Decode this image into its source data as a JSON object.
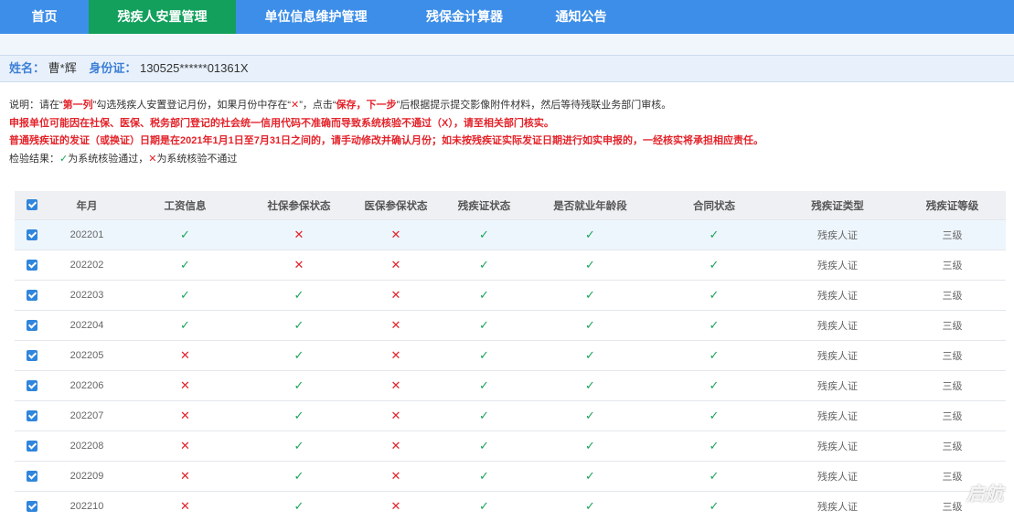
{
  "nav": {
    "items": [
      "首页",
      "残疾人安置管理",
      "单位信息维护管理",
      "残保金计算器",
      "通知公告"
    ],
    "active_index": 1
  },
  "person": {
    "name_label": "姓名：",
    "name": "曹*辉",
    "id_label": "身份证：",
    "id": "130525******01361X"
  },
  "notes": {
    "l1_prefix": "说明：请在“",
    "l1_col": "第一列",
    "l1_mid1": "”勾选残疾人安置登记月份，如果月份中存在“",
    "l1_mark": "✕",
    "l1_mid2": "”，点击“",
    "l1_btn": "保存，下一步",
    "l1_suffix": "”后根据提示提交影像附件材料，然后等待残联业务部门审核。",
    "l2": "申报单位可能因在社保、医保、税务部门登记的社会统一信用代码不准确而导致系统核验不通过（X），请至相关部门核实。",
    "l3": "普通残疾证的发证（或换证）日期是在2021年1月1日至7月31日之间的，请手动修改并确认月份；如未按残疾证实际发证日期进行如实申报的，一经核实将承担相应责任。",
    "l4_prefix": "检验结果：",
    "l4_ok_mark": "✓",
    "l4_ok_text": "为系统核验通过，",
    "l4_no_mark": "✕",
    "l4_no_text": "为系统核验不通过"
  },
  "table": {
    "headers": [
      "年月",
      "工资信息",
      "社保参保状态",
      "医保参保状态",
      "残疾证状态",
      "是否就业年龄段",
      "合同状态",
      "残疾证类型",
      "残疾证等级"
    ],
    "rows": [
      {
        "month": "202201",
        "checks": [
          "ok",
          "no",
          "no",
          "ok",
          "ok",
          "ok"
        ],
        "type": "残疾人证",
        "level": "三级"
      },
      {
        "month": "202202",
        "checks": [
          "ok",
          "no",
          "no",
          "ok",
          "ok",
          "ok"
        ],
        "type": "残疾人证",
        "level": "三级"
      },
      {
        "month": "202203",
        "checks": [
          "ok",
          "ok",
          "no",
          "ok",
          "ok",
          "ok"
        ],
        "type": "残疾人证",
        "level": "三级"
      },
      {
        "month": "202204",
        "checks": [
          "ok",
          "ok",
          "no",
          "ok",
          "ok",
          "ok"
        ],
        "type": "残疾人证",
        "level": "三级"
      },
      {
        "month": "202205",
        "checks": [
          "no",
          "ok",
          "no",
          "ok",
          "ok",
          "ok"
        ],
        "type": "残疾人证",
        "level": "三级"
      },
      {
        "month": "202206",
        "checks": [
          "no",
          "ok",
          "no",
          "ok",
          "ok",
          "ok"
        ],
        "type": "残疾人证",
        "level": "三级"
      },
      {
        "month": "202207",
        "checks": [
          "no",
          "ok",
          "no",
          "ok",
          "ok",
          "ok"
        ],
        "type": "残疾人证",
        "level": "三级"
      },
      {
        "month": "202208",
        "checks": [
          "no",
          "ok",
          "no",
          "ok",
          "ok",
          "ok"
        ],
        "type": "残疾人证",
        "level": "三级"
      },
      {
        "month": "202209",
        "checks": [
          "no",
          "ok",
          "no",
          "ok",
          "ok",
          "ok"
        ],
        "type": "残疾人证",
        "level": "三级"
      },
      {
        "month": "202210",
        "checks": [
          "no",
          "ok",
          "no",
          "ok",
          "ok",
          "ok"
        ],
        "type": "残疾人证",
        "level": "三级"
      }
    ]
  },
  "icons": {
    "ok": "✓",
    "no": "✕"
  },
  "watermark": "启航"
}
